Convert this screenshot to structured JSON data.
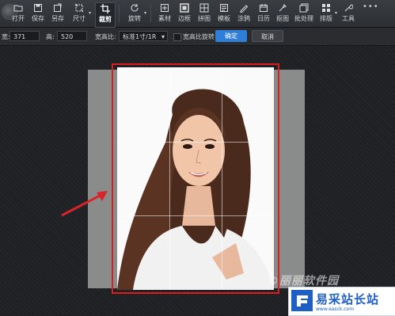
{
  "toolbar": {
    "items": [
      {
        "label": "打开",
        "icon": "open-icon"
      },
      {
        "label": "保存",
        "icon": "save-icon"
      },
      {
        "label": "另存",
        "icon": "save-as-icon"
      },
      {
        "label": "尺寸",
        "icon": "resize-icon"
      },
      {
        "label": "裁剪",
        "icon": "crop-icon",
        "active": true
      },
      {
        "label": "旋转",
        "icon": "rotate-icon"
      },
      {
        "label": "素材",
        "icon": "material-icon"
      },
      {
        "label": "边框",
        "icon": "frame-icon"
      },
      {
        "label": "拼图",
        "icon": "collage-icon"
      },
      {
        "label": "模板",
        "icon": "template-icon"
      },
      {
        "label": "涂鸦",
        "icon": "doodle-icon"
      },
      {
        "label": "日历",
        "icon": "calendar-icon"
      },
      {
        "label": "抠图",
        "icon": "cutout-icon"
      },
      {
        "label": "批处理",
        "icon": "batch-icon"
      },
      {
        "label": "排版",
        "icon": "layout-icon"
      },
      {
        "label": "工具",
        "icon": "tools-icon"
      }
    ],
    "more": "•••"
  },
  "options": {
    "width_label": "宽:",
    "width_value": "371",
    "height_label": "高:",
    "height_value": "520",
    "ratio_label": "宽高比:",
    "ratio_value": "标准1寸/1R",
    "swap_label": "宽高比旋转",
    "confirm": "确定",
    "cancel": "取消"
  },
  "watermark": "©丽丽软件园",
  "brand": {
    "name": "易采站长站",
    "url": "www.easck.com"
  },
  "colors": {
    "crop_border": "#e01b1b",
    "confirm_button": "#2f7fd8",
    "arrow": "#d8242a",
    "brand": "#1e5fc7"
  }
}
